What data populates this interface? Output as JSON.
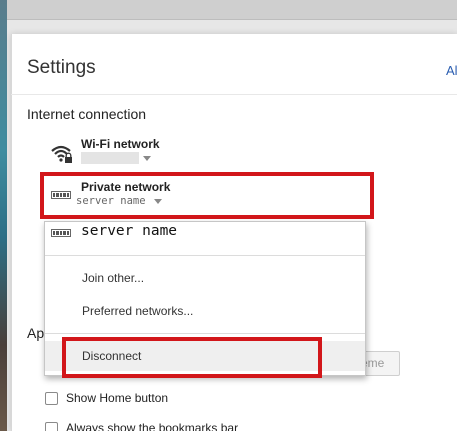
{
  "settings": {
    "title": "Settings",
    "about_link": "Al"
  },
  "internet_connection": {
    "heading": "Internet connection",
    "wifi": {
      "label": "Wi-Fi network",
      "icon": "wifi-locked-icon"
    },
    "private": {
      "label": "Private network",
      "server": "server name",
      "icon": "ethernet-icon"
    }
  },
  "dropdown": {
    "server": "server name",
    "items": [
      "Join other...",
      "Preferred networks...",
      "Disconnect"
    ]
  },
  "appearance": {
    "heading_peek": "Ap",
    "theme_button_peek": "eme"
  },
  "checkboxes": [
    {
      "label": "Show Home button",
      "checked": false
    },
    {
      "label": "Always show the bookmarks bar",
      "checked": false
    }
  ],
  "colors": {
    "highlight": "#d2161a",
    "link": "#2a5db0"
  }
}
